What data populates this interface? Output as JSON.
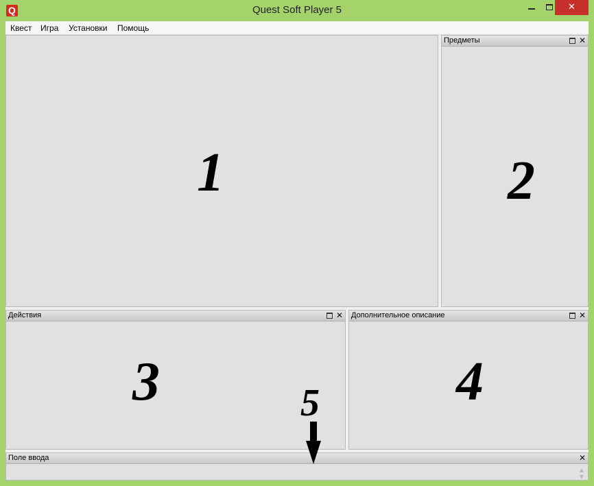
{
  "window": {
    "title": "Quest Soft Player 5",
    "app_icon_letter": "Q",
    "close_glyph": "✕"
  },
  "menu": {
    "items": [
      "Квест",
      "Игра",
      "Установки",
      "Помощь"
    ]
  },
  "panels": {
    "main": {
      "label": "1"
    },
    "items": {
      "title": "Предметы",
      "label": "2"
    },
    "actions": {
      "title": "Действия",
      "label": "3"
    },
    "description": {
      "title": "Дополнительное описание",
      "label": "4"
    },
    "input": {
      "title": "Поле ввода",
      "label": "5",
      "value": ""
    }
  },
  "glyphs": {
    "close": "✕",
    "up": "▲",
    "down": "▼"
  },
  "colors": {
    "frame": "#a5d36b",
    "close_button": "#c7302a",
    "panel_bg": "#e1e1e1"
  },
  "icons": [
    "app-q-icon",
    "minimize-icon",
    "maximize-icon",
    "close-icon",
    "panel-restore-icon",
    "panel-close-icon",
    "down-arrow-icon"
  ]
}
